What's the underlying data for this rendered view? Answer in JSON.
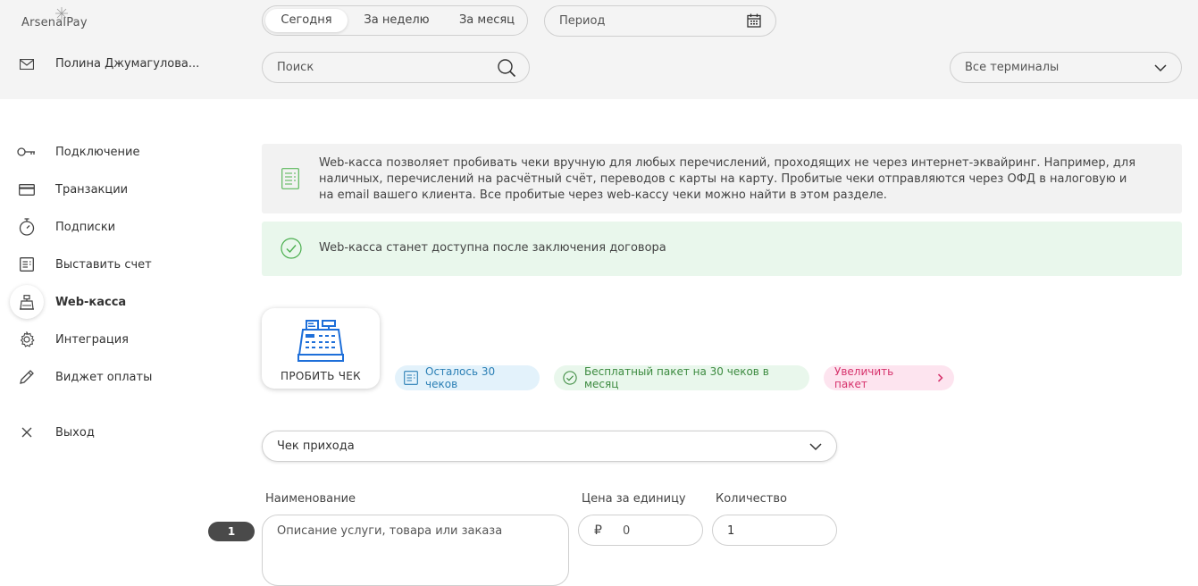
{
  "header": {
    "logo": "ArsenalPay",
    "user_name": "Полина Джумагулова...",
    "periods": [
      "Сегодня",
      "За неделю",
      "За месяц"
    ],
    "period_active": "Сегодня",
    "period_placeholder": "Период",
    "search_placeholder": "Поиск",
    "terminal_select": "Все терминалы"
  },
  "sidebar": {
    "items": [
      {
        "label": "Подключение",
        "icon": "key-icon"
      },
      {
        "label": "Транзакции",
        "icon": "card-icon"
      },
      {
        "label": "Подписки",
        "icon": "stopwatch-icon"
      },
      {
        "label": "Выставить счет",
        "icon": "invoice-icon"
      },
      {
        "label": "Web-касса",
        "icon": "cash-register-icon",
        "active": true
      },
      {
        "label": "Интеграция",
        "icon": "gear-icon"
      },
      {
        "label": "Виджет оплаты",
        "icon": "pencil-icon"
      },
      {
        "label": "Выход",
        "icon": "close-icon"
      }
    ]
  },
  "main": {
    "info_text": "Web-касса позволяет пробивать чеки вручную для любых перечислений, проходящих не через интернет-эквайринг. Например, для наличных, перечислений на расчётный счёт, переводов с карты на карту. Пробитые чеки отправляются через ОФД в налоговую и на email вашего клиента. Все пробитые через web-кассу чеки можно найти в этом разделе.",
    "notice_text": "Web-касса станет доступна после заключения договора",
    "punch_button": "ПРОБИТЬ ЧЕК",
    "chips": {
      "remaining": "Осталось 30 чеков",
      "free_package": "Бесплатный пакет на 30 чеков в месяц",
      "increase": "Увеличить пакет"
    },
    "receipt_type": "Чек прихода",
    "form": {
      "name_label": "Наименование",
      "price_label": "Цена за единицу",
      "qty_label": "Количество",
      "row_number": "1",
      "name_placeholder": "Описание услуги, товара или заказа",
      "currency": "₽",
      "price_value": "0",
      "qty_value": "1"
    }
  },
  "colors": {
    "accent_blue": "#1e6fd9",
    "green": "#4caf50",
    "notice_bg": "#e9f7ec",
    "pink": "#d6336c"
  }
}
